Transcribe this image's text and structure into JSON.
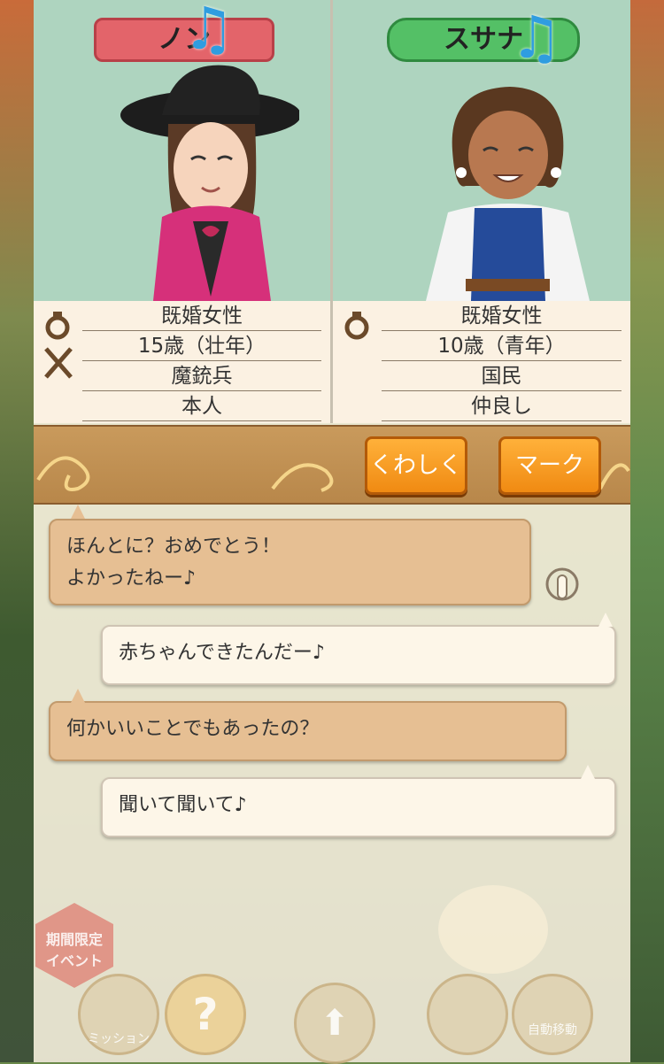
{
  "characters": [
    {
      "name": "ノン",
      "name_color": "#e3646a",
      "icon": "ring-icon",
      "icon2": "crossed-swords-icon",
      "info": [
        "既婚女性",
        "15歳（壮年）",
        "魔銃兵",
        "本人"
      ]
    },
    {
      "name": "スサナ",
      "name_color": "#54c066",
      "icon": "ring-icon",
      "info": [
        "既婚女性",
        "10歳（青年）",
        "国民",
        "仲良し"
      ]
    }
  ],
  "buttons": {
    "detail": "くわしく",
    "mark": "マーク"
  },
  "chat": [
    {
      "speaker": "left",
      "lines": [
        "ほんとに？おめでとう！",
        "よかったねー♪"
      ]
    },
    {
      "speaker": "right",
      "lines": [
        "赤ちゃんできたんだー♪"
      ]
    },
    {
      "speaker": "left",
      "lines": [
        "何かいいことでもあったの？"
      ]
    },
    {
      "speaker": "right",
      "lines": [
        "聞いて聞いて♪"
      ]
    }
  ],
  "hud": {
    "event_label_1": "期間限定",
    "event_label_2": "イベント",
    "mission": "ミッション",
    "auto_move": "自動移動",
    "help_glyph": "?",
    "up_glyph": "⬆"
  },
  "colors": {
    "accent_orange": "#f08a12",
    "portrait_bg": "#aed4bf",
    "bubble_brown": "#e6bf93",
    "bubble_white": "#fdf6e8"
  }
}
